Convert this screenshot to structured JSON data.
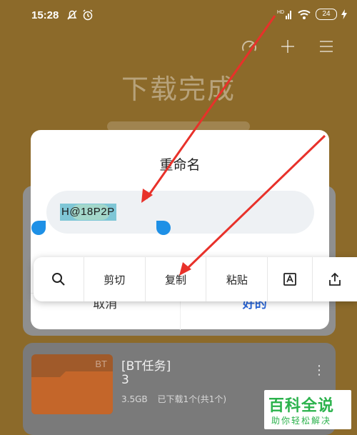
{
  "status_bar": {
    "time": "15:28",
    "left_icons": [
      "bell-off-icon",
      "alarm-icon"
    ],
    "right_icons": [
      "hd-signal-icon",
      "wifi-icon",
      "battery-icon",
      "charging-icon"
    ],
    "battery": "24"
  },
  "header": {
    "title": "下载完成",
    "actions": [
      "speed-icon",
      "plus-icon",
      "menu-icon"
    ]
  },
  "dialog": {
    "title": "重命名",
    "input_value": "H@18P2P",
    "cancel_label": "取消",
    "ok_label": "好的"
  },
  "context_menu": {
    "items": [
      {
        "icon": "search-icon"
      },
      {
        "label": "剪切"
      },
      {
        "label": "复制"
      },
      {
        "label": "粘贴"
      },
      {
        "icon": "text-recognition-icon"
      },
      {
        "icon": "share-icon"
      }
    ]
  },
  "list_item": {
    "tag": "BT",
    "title": "[BT任务]",
    "title_line2": "3",
    "size": "3.5GB",
    "status": "已下载1个(共1个)"
  },
  "watermark": {
    "title": "百科全说",
    "subtitle": "助你轻松解决"
  },
  "colors": {
    "arrow": "#e8312a",
    "accent": "#2a66d8",
    "selection": "#7fc6d6",
    "handle": "#1e90e6",
    "watermark": "#2bb24c"
  }
}
